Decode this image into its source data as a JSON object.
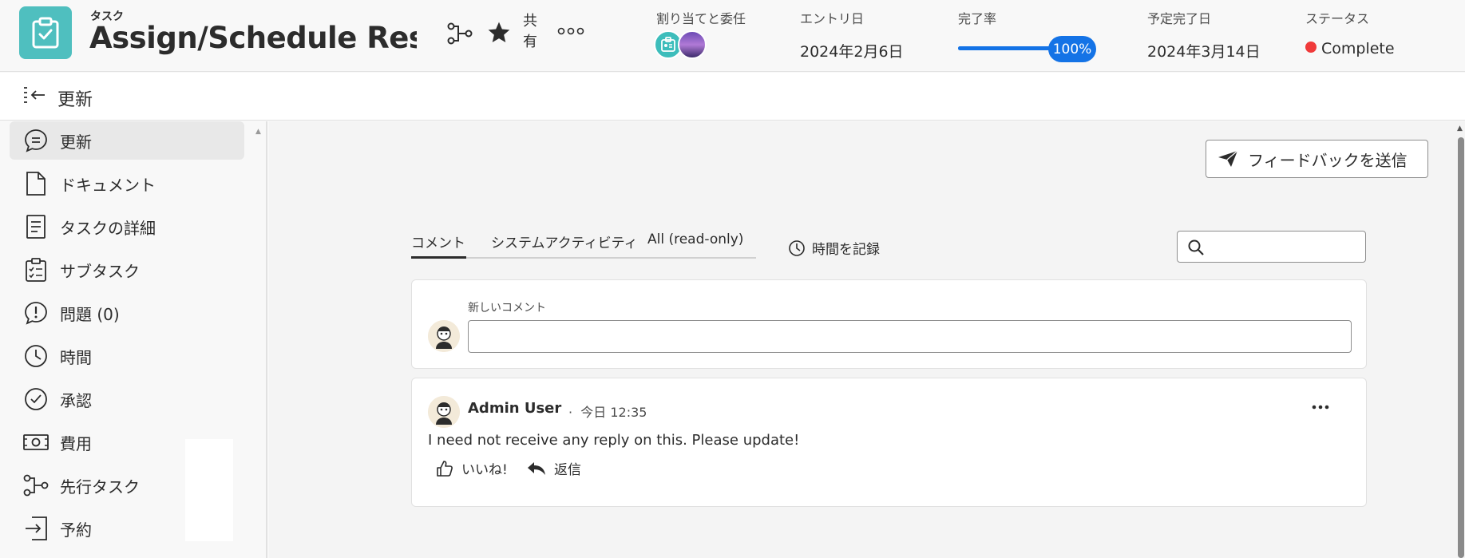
{
  "header": {
    "object_type": "タスク",
    "title": "Assign/Schedule Res…",
    "share_label": "共有",
    "icons": [
      "workflow-icon",
      "star-icon",
      "more-icon"
    ],
    "fields": {
      "assignment": {
        "label": "割り当てと委任"
      },
      "entry_date": {
        "label": "エントリ日",
        "value": "2024年2月6日"
      },
      "percent_complete": {
        "label": "完了率",
        "value": "100%",
        "fraction": 1.0
      },
      "planned_completion": {
        "label": "予定完了日",
        "value": "2024年3月14日"
      },
      "status": {
        "label": "ステータス",
        "value": "Complete",
        "color": "#f03a3a"
      }
    },
    "accent_color": "#1473e6",
    "object_icon_color": "#4fbfbf"
  },
  "subheader": {
    "title": "更新"
  },
  "sidebar": {
    "items": [
      {
        "label": "更新",
        "icon": "comment-icon",
        "active": true
      },
      {
        "label": "ドキュメント",
        "icon": "document-icon"
      },
      {
        "label": "タスクの詳細",
        "icon": "details-icon"
      },
      {
        "label": "サブタスク",
        "icon": "subtask-icon"
      },
      {
        "label": "問題 (0)",
        "icon": "issue-icon"
      },
      {
        "label": "時間",
        "icon": "clock-icon"
      },
      {
        "label": "承認",
        "icon": "approval-icon"
      },
      {
        "label": "費用",
        "icon": "expense-icon"
      },
      {
        "label": "先行タスク",
        "icon": "predecessor-icon"
      },
      {
        "label": "予約",
        "icon": "booking-icon"
      }
    ]
  },
  "main": {
    "feedback_button": "フィードバックを送信",
    "tabs": [
      {
        "label": "コメント",
        "active": true
      },
      {
        "label": "システムアクティビティ"
      },
      {
        "label": "All (read-only)"
      }
    ],
    "log_time": "時間を記録",
    "search": {
      "placeholder": ""
    },
    "new_comment": {
      "label": "新しいコメント",
      "value": ""
    },
    "comments": [
      {
        "author": "Admin User",
        "time": "今日 12:35",
        "text": "I need not receive any reply on this. Please update!",
        "actions": {
          "like": "いいね!",
          "reply": "返信"
        }
      }
    ]
  }
}
